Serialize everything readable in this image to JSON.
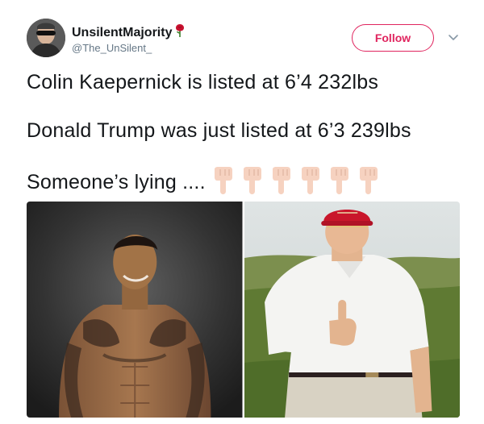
{
  "header": {
    "display_name": "UnsilentMajority",
    "handle": "@The_UnSilent_",
    "follow_label": "Follow",
    "name_emoji": "rose-icon",
    "menu_icon": "chevron-down-icon"
  },
  "tweet": {
    "lines": [
      "Colin Kaepernick is listed at 6’4 232lbs",
      "Donald Trump was just listed at 6’3 239lbs",
      "Someone’s lying ...."
    ],
    "emoji": {
      "icon": "point-down-icon",
      "count": 6
    }
  },
  "media": {
    "photos": [
      {
        "icon": "shirtless-tattooed-man-photo"
      },
      {
        "icon": "man-thumbs-up-red-cap-photo"
      }
    ]
  },
  "colors": {
    "follow_accent": "#e0245e",
    "text": "#14171a",
    "handle": "#657786",
    "emoji_skin": "#f6d2c0"
  }
}
